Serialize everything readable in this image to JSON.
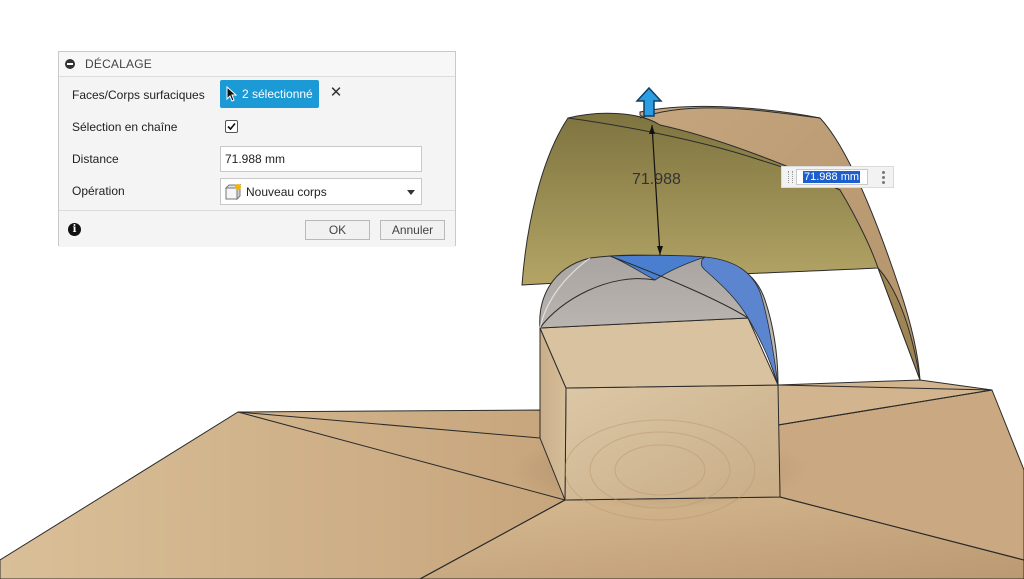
{
  "dialog": {
    "title": "DÉCALAGE",
    "faces_label": "Faces/Corps surfaciques",
    "selection_button": "2 sélectionné",
    "chain_label": "Sélection en chaîne",
    "chain_checked": true,
    "distance_label": "Distance",
    "distance_value": "71.988 mm",
    "operation_label": "Opération",
    "operation_value": "Nouveau corps",
    "ok_label": "OK",
    "cancel_label": "Annuler"
  },
  "viewport": {
    "dimension_text": "71.988",
    "dimension_input": "71.988 mm"
  },
  "colors": {
    "accent": "#1b9ad6",
    "selection_blue": "#4a7fd0",
    "offset_surface": "#9a8d52",
    "wood": "#cdb08a"
  }
}
